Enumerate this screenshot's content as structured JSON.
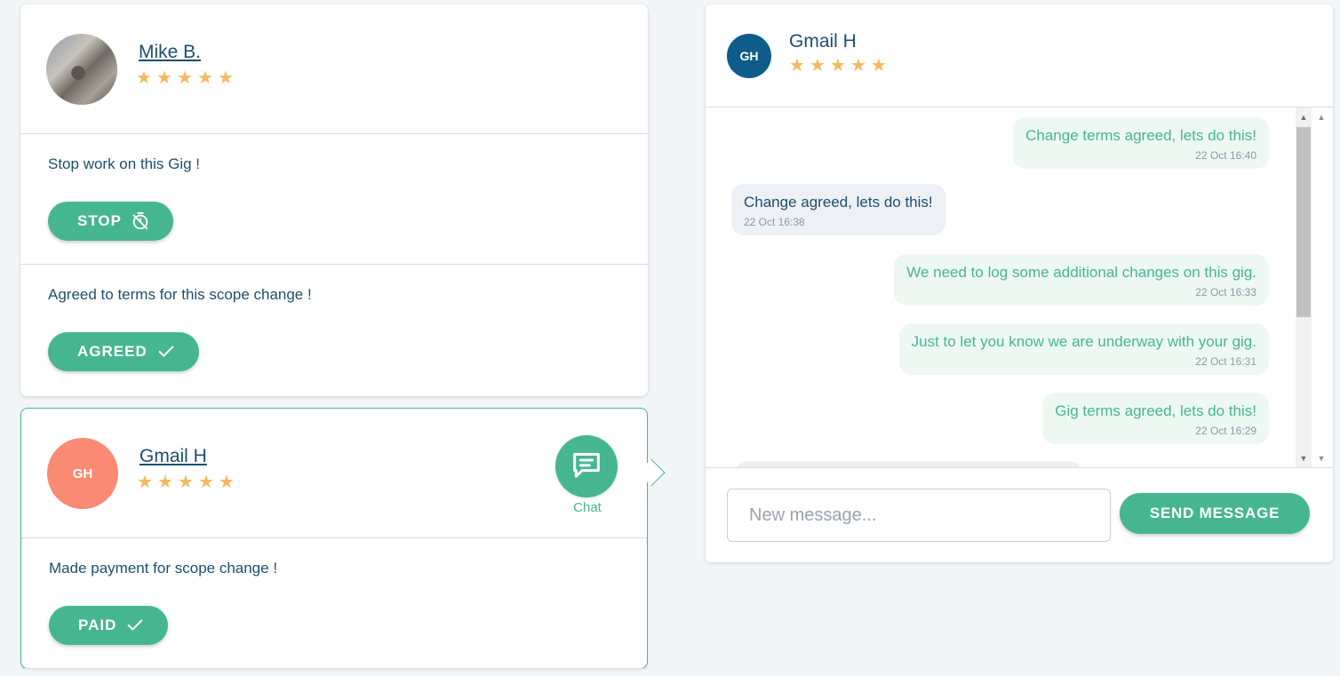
{
  "colors": {
    "accent": "#46b690",
    "text": "#1d4f6e",
    "star": "#f5b95f",
    "avatar_gh_salmon": "#fa8a73",
    "avatar_gh_blue": "#0d5c8a"
  },
  "cards": [
    {
      "user": {
        "name": "Mike B.",
        "rating": 5,
        "avatar": "photo"
      },
      "sections": [
        {
          "text": "Stop work on this Gig !",
          "button": "STOP",
          "button_icon": "timer-off-icon"
        },
        {
          "text": "Agreed to terms for this scope change !",
          "button": "AGREED",
          "button_icon": "check-icon"
        }
      ]
    },
    {
      "user": {
        "name": "Gmail H",
        "initials": "GH",
        "rating": 5
      },
      "chat_label": "Chat",
      "sections": [
        {
          "text": "Made payment for scope change !",
          "button": "PAID",
          "button_icon": "check-icon"
        }
      ]
    }
  ],
  "chat": {
    "header": {
      "name": "Gmail H",
      "initials": "GH",
      "rating": 5
    },
    "messages": [
      {
        "direction": "out",
        "text": "Change terms agreed, lets do this!",
        "time": "22 Oct 16:40"
      },
      {
        "direction": "in",
        "text": "Change agreed, lets do this!",
        "time": "22 Oct 16:38"
      },
      {
        "direction": "out",
        "text": "We need to log some additional changes on this gig.",
        "time": "22 Oct 16:33"
      },
      {
        "direction": "out",
        "text": "Just to let you know we are underway with your gig.",
        "time": "22 Oct 16:31"
      },
      {
        "direction": "out",
        "text": "Gig terms agreed, lets do this!",
        "time": "22 Oct 16:29"
      }
    ],
    "compose_placeholder": "New message...",
    "send_label": "SEND MESSAGE"
  }
}
